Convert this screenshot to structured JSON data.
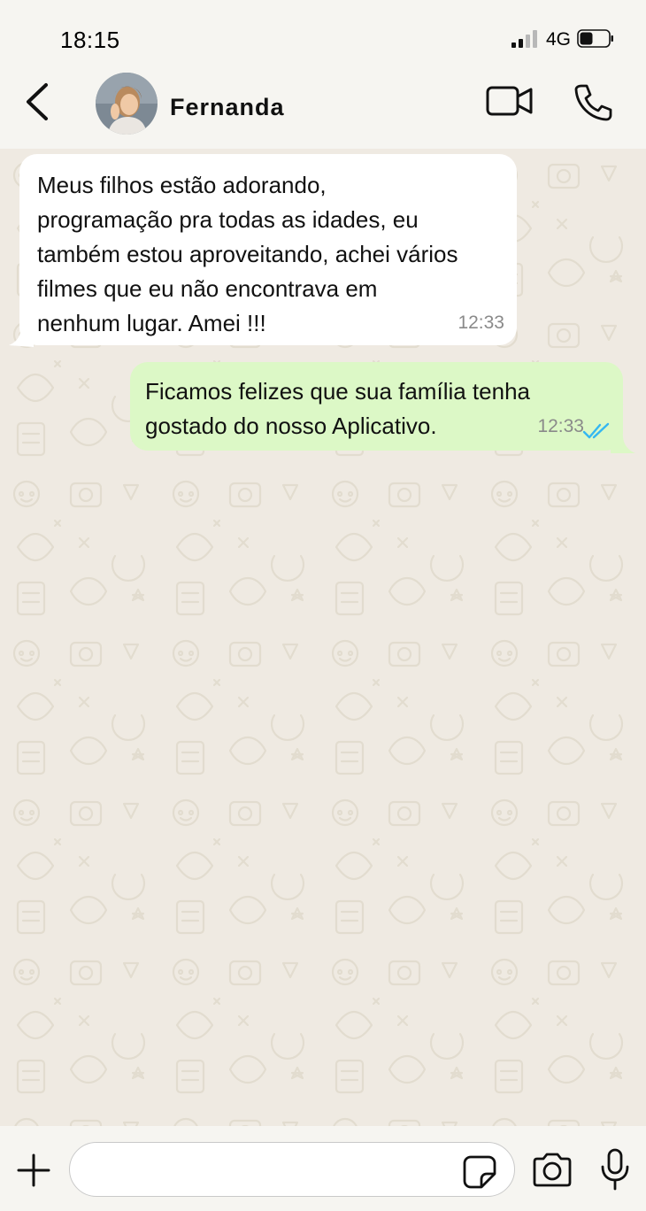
{
  "status_bar": {
    "time": "18:15",
    "network": "4G",
    "signal_bars_active": 2,
    "signal_bars_total": 4,
    "battery_level": 0.45
  },
  "header": {
    "contact_name": "Fernanda",
    "back_icon": "chevron-left-icon",
    "video_icon": "video-camera-icon",
    "call_icon": "phone-icon"
  },
  "messages": [
    {
      "direction": "incoming",
      "text": "Meus filhos estão adorando,\nprogramação pra todas as idades, eu\ntambém estou aproveitando, achei vários\nfilmes que eu não encontrava em\nnenhum lugar. Amei !!!",
      "time": "12:33"
    },
    {
      "direction": "outgoing",
      "text": "Ficamos felizes que sua família tenha\ngostado do nosso Aplicativo.",
      "time": "12:33",
      "status": "read"
    }
  ],
  "input_bar": {
    "message_value": "",
    "plus_icon": "plus-icon",
    "sticker_icon": "sticker-icon",
    "camera_icon": "camera-icon",
    "mic_icon": "microphone-icon"
  },
  "colors": {
    "header_bg": "#f6f5f1",
    "chat_bg": "#efeae2",
    "incoming_bubble": "#ffffff",
    "outgoing_bubble": "#dcf8c6",
    "read_tick": "#34b7f1",
    "timestamp": "#8a8a8a"
  }
}
